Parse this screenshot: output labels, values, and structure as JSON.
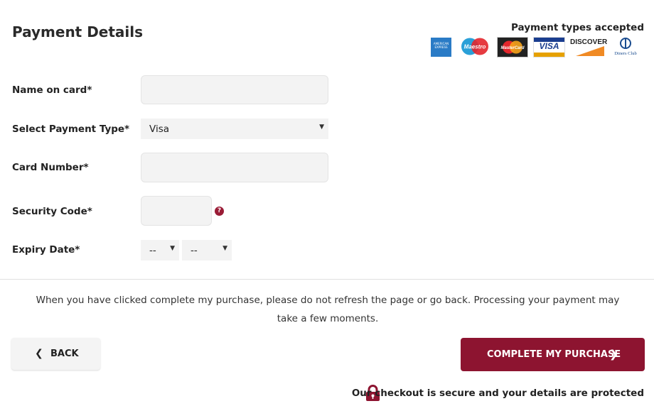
{
  "header": {
    "title": "Payment Details",
    "types_label": "Payment types accepted",
    "card_logos": [
      "amex-icon",
      "maestro-icon",
      "mastercard-icon",
      "visa-icon",
      "discover-icon",
      "diners-club-icon"
    ],
    "logo_text": {
      "amex": "AMERICAN EXPRESS",
      "maestro": "Maestro",
      "mastercard": "MasterCard",
      "visa": "VISA",
      "discover": "DISCOVER",
      "diners": "Diners Club"
    }
  },
  "form": {
    "name_label": "Name on card*",
    "name_value": "",
    "type_label": "Select Payment Type*",
    "type_selected": "Visa",
    "number_label": "Card Number*",
    "number_value": "",
    "security_label": "Security Code*",
    "security_value": "",
    "help_glyph": "?",
    "expiry_label": "Expiry Date*",
    "expiry_month": "--",
    "expiry_year": "--"
  },
  "note": "When you have clicked complete my purchase, please do not refresh the page or go back. Processing your payment may take a few moments.",
  "buttons": {
    "back": "BACK",
    "complete": "COMPLETE MY PURCHASE"
  },
  "footer": {
    "secure_text": "Our checkout is secure and your details are protected"
  },
  "colors": {
    "accent": "#8d1430",
    "field_bg": "#f3f3f3"
  }
}
